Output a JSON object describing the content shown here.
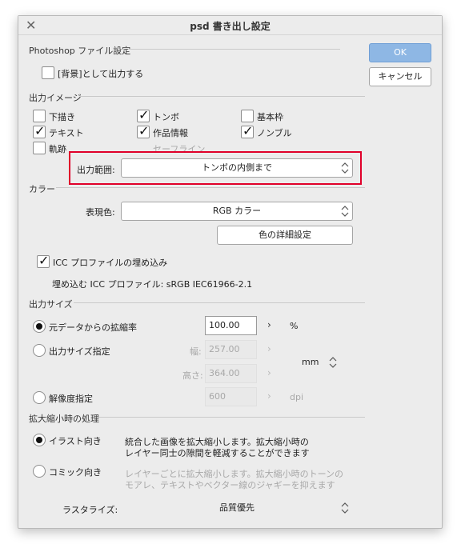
{
  "dialog": {
    "title": "psd 書き出し設定",
    "ok_label": "OK",
    "cancel_label": "キャンセル"
  },
  "photoshop": {
    "section": "Photoshop ファイル設定",
    "background_layer": {
      "label": "[背景]として出力する",
      "checked": false
    }
  },
  "output_image": {
    "section": "出力イメージ",
    "options": {
      "draft": {
        "label": "下描き",
        "checked": false
      },
      "text": {
        "label": "テキスト",
        "checked": true
      },
      "trace": {
        "label": "軌跡",
        "checked": false
      },
      "tombo": {
        "label": "トンボ",
        "checked": true
      },
      "work_info": {
        "label": "作品情報",
        "checked": true
      },
      "safe_line": {
        "label": "セーフライン",
        "checked": false
      },
      "basic_frame": {
        "label": "基本枠",
        "checked": false
      },
      "nombre": {
        "label": "ノンブル",
        "checked": true
      }
    },
    "range_label": "出力範囲:",
    "range_value": "トンボの内側まで"
  },
  "color": {
    "section": "カラー",
    "mode_label": "表現色:",
    "mode_value": "RGB カラー",
    "details_button": "色の詳細設定",
    "icc_embed": {
      "label": "ICC プロファイルの埋め込み",
      "checked": true
    },
    "icc_profile_text": "埋め込む ICC プロファイル: sRGB IEC61966-2.1"
  },
  "output_size": {
    "section": "出力サイズ",
    "scale": {
      "label": "元データからの拡縮率",
      "value": "100.00",
      "unit": "%",
      "selected": true
    },
    "size": {
      "label": "出力サイズ指定",
      "width_label": "幅:",
      "width_value": "257.00",
      "height_label": "高さ:",
      "height_value": "364.00",
      "unit": "mm",
      "selected": false
    },
    "resolution": {
      "label": "解像度指定",
      "value": "600",
      "unit": "dpi",
      "selected": false
    }
  },
  "scaling": {
    "section": "拡大縮小時の処理",
    "illust": {
      "label": "イラスト向き",
      "desc1": "統合した画像を拡大縮小します。拡大縮小時の",
      "desc2": "レイヤー同士の隙間を軽減することができます",
      "selected": true
    },
    "comic": {
      "label": "コミック向き",
      "desc1": "レイヤーごとに拡大縮小します。拡大縮小時のトーンの",
      "desc2": "モアレ、テキストやベクター線のジャギーを抑えます",
      "selected": false
    },
    "rasterize_label": "ラスタライズ:",
    "rasterize_value": "品質優先"
  },
  "colors": {
    "accent": "#8eb7e4",
    "highlight": "#e0002a"
  }
}
